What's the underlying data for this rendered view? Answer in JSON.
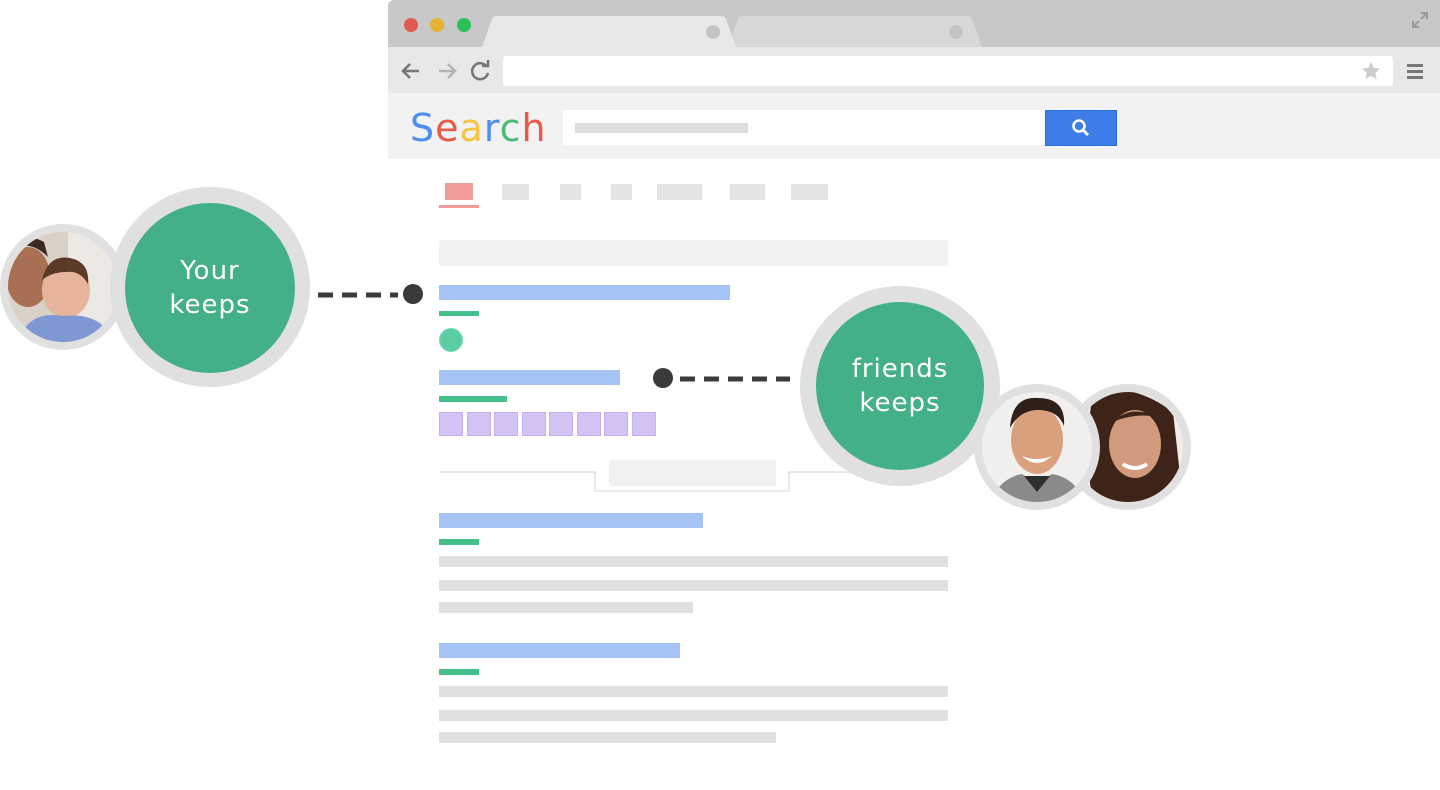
{
  "browser": {
    "traffic_lights": [
      {
        "name": "close",
        "color": "#e25a52"
      },
      {
        "name": "minimize",
        "color": "#e6b232"
      },
      {
        "name": "zoom",
        "color": "#2cc158"
      }
    ],
    "tabs": [
      {
        "label": "",
        "active": true
      },
      {
        "label": "",
        "active": false
      }
    ],
    "icons": [
      "back-arrow-icon",
      "forward-arrow-icon",
      "reload-icon",
      "bookmark-star-icon",
      "hamburger-menu-icon",
      "expand-icon"
    ],
    "address_bar_value": ""
  },
  "search": {
    "logo_text": "Search",
    "logo_letters": [
      {
        "ch": "S",
        "color": "#4d8ef0"
      },
      {
        "ch": "e",
        "color": "#e65b49"
      },
      {
        "ch": "a",
        "color": "#f6c344"
      },
      {
        "ch": "r",
        "color": "#4d8ef0"
      },
      {
        "ch": "c",
        "color": "#4dbb75"
      },
      {
        "ch": "h",
        "color": "#e65b49"
      }
    ],
    "button_icon": "magnifier-icon",
    "button_color": "#3f7ee8"
  },
  "callouts": {
    "your_keeps": "Your keeps",
    "your_keeps_line1": "Your",
    "your_keeps_line2": "keeps",
    "friends_keeps": "friends keeps",
    "friends_keeps_line1": "friends",
    "friends_keeps_line2": "keeps",
    "bubble_color": "#44b088"
  },
  "colors": {
    "result_title": "#a4c2f4",
    "result_url": "#45c08a",
    "image_result": "#d3c3f4",
    "active_tab": "#f29b9b"
  }
}
